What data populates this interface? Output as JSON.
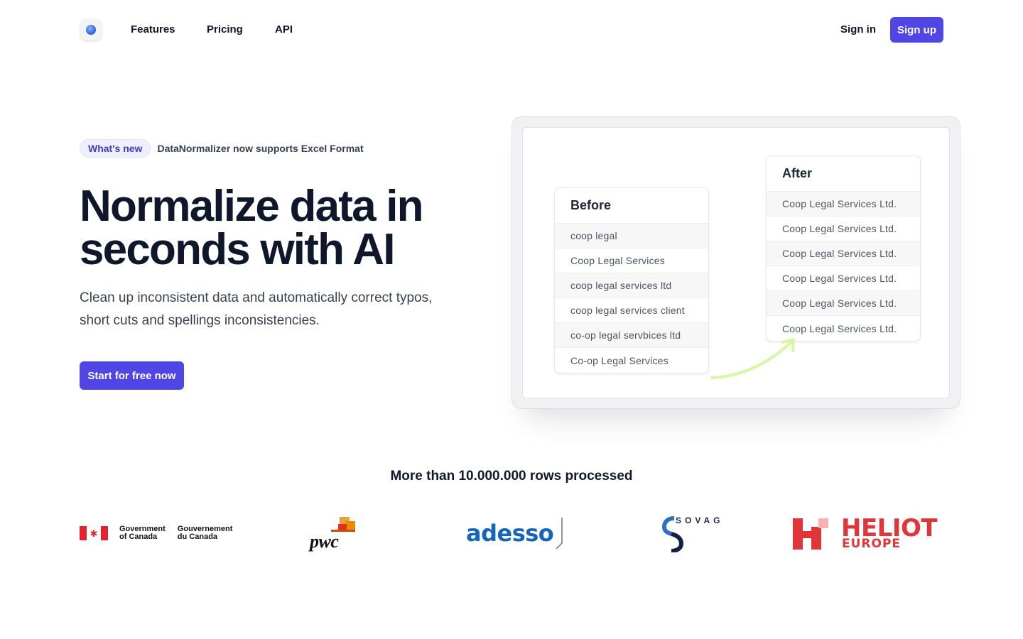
{
  "nav": {
    "links": [
      {
        "label": "Features"
      },
      {
        "label": "Pricing"
      },
      {
        "label": "API"
      }
    ],
    "signin_label": "Sign in",
    "signup_label": "Sign up"
  },
  "announcement": {
    "badge": "What's new",
    "text": "DataNormalizer now supports Excel Format"
  },
  "hero": {
    "title": "Normalize data in seconds with AI",
    "subtitle": "Clean up inconsistent data and automatically correct typos, short cuts and spellings inconsistencies.",
    "cta_label": "Start for free now"
  },
  "demo": {
    "before": {
      "title": "Before",
      "rows": [
        "coop legal",
        "Coop Legal Services",
        "coop legal services ltd",
        "coop legal services client",
        "co-op legal servbices ltd",
        "Co-op Legal Services"
      ]
    },
    "after": {
      "title": "After",
      "rows": [
        "Coop Legal Services Ltd.",
        "Coop Legal Services Ltd.",
        "Coop Legal Services Ltd.",
        "Coop Legal Services Ltd.",
        "Coop Legal Services Ltd.",
        "Coop Legal Services Ltd."
      ]
    },
    "arrow_color": "#d6f7a3"
  },
  "proof": {
    "title": "More than 10.000.000 rows processed",
    "logos": {
      "canada": {
        "en_line1": "Government",
        "en_line2": "of Canada",
        "fr_line1": "Gouvernement",
        "fr_line2": "du Canada"
      },
      "pwc": {
        "text": "pwc"
      },
      "adesso": {
        "text": "adesso"
      },
      "sovag": {
        "text": "SOVAG"
      },
      "heliot": {
        "main": "HELIOT",
        "sub": "EUROPE"
      }
    }
  },
  "colors": {
    "accent": "#4f46e5",
    "badge_bg": "#eef0ff",
    "heliot_red": "#e0363a",
    "adesso_blue": "#1565c0"
  }
}
